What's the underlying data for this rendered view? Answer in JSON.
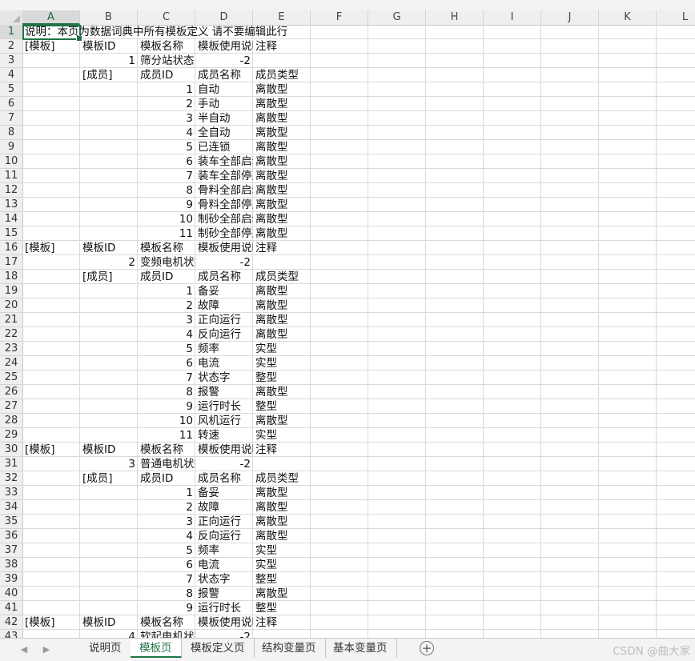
{
  "columns": [
    "A",
    "B",
    "C",
    "D",
    "E",
    "F",
    "G",
    "H",
    "I",
    "J",
    "K",
    "L"
  ],
  "selected_column": "A",
  "selected_row": 1,
  "rows": [
    {
      "n": 1,
      "A": "说明：本页为数据词典中所有模板定义   请不要编辑此行"
    },
    {
      "n": 2,
      "A": "[模板]",
      "B": "模板ID",
      "C": "模板名称",
      "D": "模板使用说明",
      "E": "注释"
    },
    {
      "n": 3,
      "B": "1",
      "C": "筛分站状态",
      "D": "-2"
    },
    {
      "n": 4,
      "B": "[成员]",
      "C": "成员ID",
      "D": "成员名称",
      "E": "成员类型"
    },
    {
      "n": 5,
      "C": "1",
      "D": "自动",
      "E": "离散型"
    },
    {
      "n": 6,
      "C": "2",
      "D": "手动",
      "E": "离散型"
    },
    {
      "n": 7,
      "C": "3",
      "D": "半自动",
      "E": "离散型"
    },
    {
      "n": 8,
      "C": "4",
      "D": "全自动",
      "E": "离散型"
    },
    {
      "n": 9,
      "C": "5",
      "D": "已连锁",
      "E": "离散型"
    },
    {
      "n": 10,
      "C": "6",
      "D": "装车全部启动",
      "E": "离散型"
    },
    {
      "n": 11,
      "C": "7",
      "D": "装车全部停止",
      "E": "离散型"
    },
    {
      "n": 12,
      "C": "8",
      "D": "骨料全部启动",
      "E": "离散型"
    },
    {
      "n": 13,
      "C": "9",
      "D": "骨料全部停止",
      "E": "离散型"
    },
    {
      "n": 14,
      "C": "10",
      "D": "制砂全部启动",
      "E": "离散型"
    },
    {
      "n": 15,
      "C": "11",
      "D": "制砂全部停止",
      "E": "离散型"
    },
    {
      "n": 16,
      "A": "[模板]",
      "B": "模板ID",
      "C": "模板名称",
      "D": "模板使用说明",
      "E": "注释"
    },
    {
      "n": 17,
      "B": "2",
      "C": "变频电机状态",
      "D": "-2"
    },
    {
      "n": 18,
      "B": "[成员]",
      "C": "成员ID",
      "D": "成员名称",
      "E": "成员类型"
    },
    {
      "n": 19,
      "C": "1",
      "D": "备妥",
      "E": "离散型"
    },
    {
      "n": 20,
      "C": "2",
      "D": "故障",
      "E": "离散型"
    },
    {
      "n": 21,
      "C": "3",
      "D": "正向运行",
      "E": "离散型"
    },
    {
      "n": 22,
      "C": "4",
      "D": "反向运行",
      "E": "离散型"
    },
    {
      "n": 23,
      "C": "5",
      "D": "频率",
      "E": "实型"
    },
    {
      "n": 24,
      "C": "6",
      "D": "电流",
      "E": "实型"
    },
    {
      "n": 25,
      "C": "7",
      "D": "状态字",
      "E": "整型"
    },
    {
      "n": 26,
      "C": "8",
      "D": "报警",
      "E": "离散型"
    },
    {
      "n": 27,
      "C": "9",
      "D": "运行时长",
      "E": "整型"
    },
    {
      "n": 28,
      "C": "10",
      "D": "风机运行",
      "E": "离散型"
    },
    {
      "n": 29,
      "C": "11",
      "D": "转速",
      "E": "实型"
    },
    {
      "n": 30,
      "A": "[模板]",
      "B": "模板ID",
      "C": "模板名称",
      "D": "模板使用说明",
      "E": "注释"
    },
    {
      "n": 31,
      "B": "3",
      "C": "普通电机状态",
      "D": "-2"
    },
    {
      "n": 32,
      "B": "[成员]",
      "C": "成员ID",
      "D": "成员名称",
      "E": "成员类型"
    },
    {
      "n": 33,
      "C": "1",
      "D": "备妥",
      "E": "离散型"
    },
    {
      "n": 34,
      "C": "2",
      "D": "故障",
      "E": "离散型"
    },
    {
      "n": 35,
      "C": "3",
      "D": "正向运行",
      "E": "离散型"
    },
    {
      "n": 36,
      "C": "4",
      "D": "反向运行",
      "E": "离散型"
    },
    {
      "n": 37,
      "C": "5",
      "D": "频率",
      "E": "实型"
    },
    {
      "n": 38,
      "C": "6",
      "D": "电流",
      "E": "实型"
    },
    {
      "n": 39,
      "C": "7",
      "D": "状态字",
      "E": "整型"
    },
    {
      "n": 40,
      "C": "8",
      "D": "报警",
      "E": "离散型"
    },
    {
      "n": 41,
      "C": "9",
      "D": "运行时长",
      "E": "整型"
    },
    {
      "n": 42,
      "A": "[模板]",
      "B": "模板ID",
      "C": "模板名称",
      "D": "模板使用说明",
      "E": "注释"
    },
    {
      "n": 43,
      "B": "4",
      "C": "软起电机状态",
      "D": "-2"
    }
  ],
  "sheet_tabs": [
    "说明页",
    "模板页",
    "模板定义页",
    "结构变量页",
    "基本变量页"
  ],
  "active_tab": "模板页",
  "icons": {
    "prev": "chevron-left-icon",
    "next": "chevron-right-icon",
    "add": "plus-circle-icon"
  },
  "watermark": "CSDN @曲大家",
  "colors": {
    "accent": "#217346",
    "grid": "#dadada",
    "header_bg": "#efefef"
  }
}
